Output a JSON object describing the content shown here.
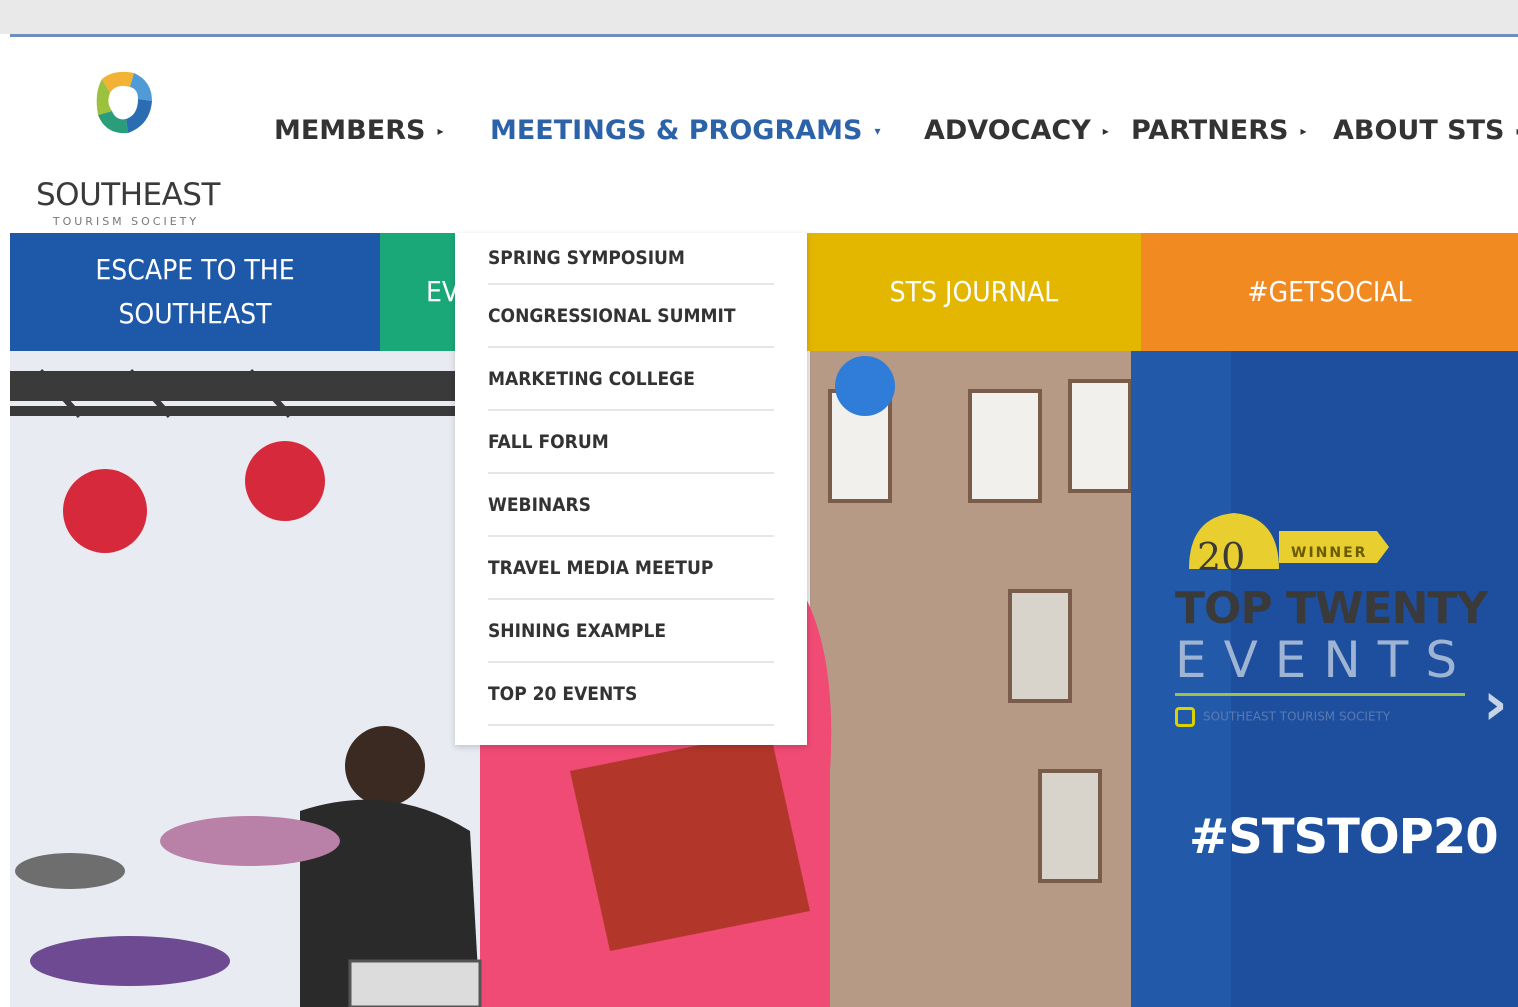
{
  "logo": {
    "name": "SOUTHEAST",
    "tagline": "TOURISM SOCIETY"
  },
  "nav": [
    {
      "label": "MEMBERS",
      "active": false
    },
    {
      "label": "MEETINGS & PROGRAMS",
      "active": true
    },
    {
      "label": "ADVOCACY",
      "active": false
    },
    {
      "label": "PARTNERS",
      "active": false
    },
    {
      "label": "ABOUT STS",
      "active": false
    }
  ],
  "tiles": {
    "escape": "ESCAPE TO THE SOUTHEAST",
    "events_partial": "EV",
    "journal": "STS JOURNAL",
    "social": "#GETSOCIAL"
  },
  "dropdown": [
    "SPRING SYMPOSIUM",
    "CONGRESSIONAL SUMMIT",
    "MARKETING COLLEGE",
    "FALL FORUM",
    "WEBINARS",
    "TRAVEL MEDIA MEETUP",
    "SHINING EXAMPLE",
    "TOP 20 EVENTS"
  ],
  "promo": {
    "seal_number": "20",
    "seal_label": "WINNER",
    "title_top": "TOP TWENTY",
    "title_bottom": "EVENTS",
    "org": "SOUTHEAST TOURISM SOCIETY",
    "hashtag": "#STSTOP20"
  },
  "colors": {
    "nav_active": "#2c63a8",
    "tile_escape": "#1e58a8",
    "tile_events": "#1ba879",
    "tile_journal": "#e3b700",
    "tile_social": "#f28a22",
    "promo_bg": "#1d4f9e"
  },
  "icons": {
    "nav_arrow": "caret-right-icon",
    "nav_arrow_active": "caret-down-icon",
    "slider_next": "chevron-right-icon"
  }
}
